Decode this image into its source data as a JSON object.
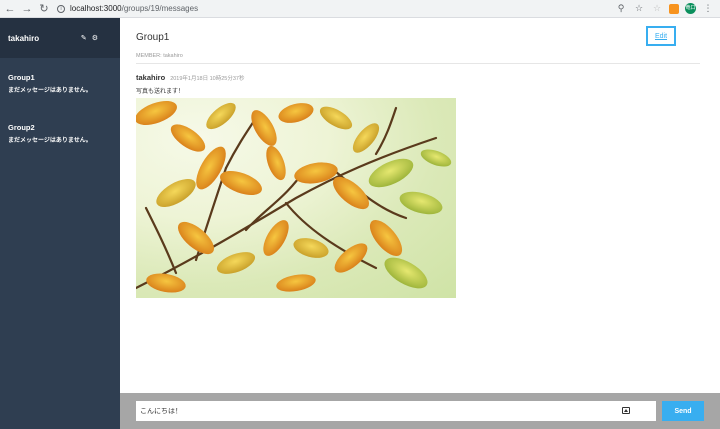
{
  "browser": {
    "url_host": "localhost:3000",
    "url_path": "/groups/19/messages",
    "profile_initials": "竜口"
  },
  "sidebar": {
    "user_name": "takahiro",
    "groups": [
      {
        "name": "Group1",
        "last_message": "まだメッセージはありません。"
      },
      {
        "name": "Group2",
        "last_message": "まだメッセージはありません。"
      }
    ]
  },
  "main": {
    "group_title": "Group1",
    "members": "MEMBER: takahiro",
    "edit_label": "Edit"
  },
  "messages": [
    {
      "user": "takahiro",
      "date": "2019年1月18日 10時25分37秒",
      "text": "写真も送れます！",
      "image_desc": "autumn-leaves-photo"
    }
  ],
  "footer": {
    "input_value": "こんにちは！",
    "send_label": "Send"
  },
  "colors": {
    "sidebar_bg": "#2f3e51",
    "sidebar_header_bg": "#253141",
    "accent": "#38aef0",
    "footer_bg": "#a6a6a6"
  }
}
